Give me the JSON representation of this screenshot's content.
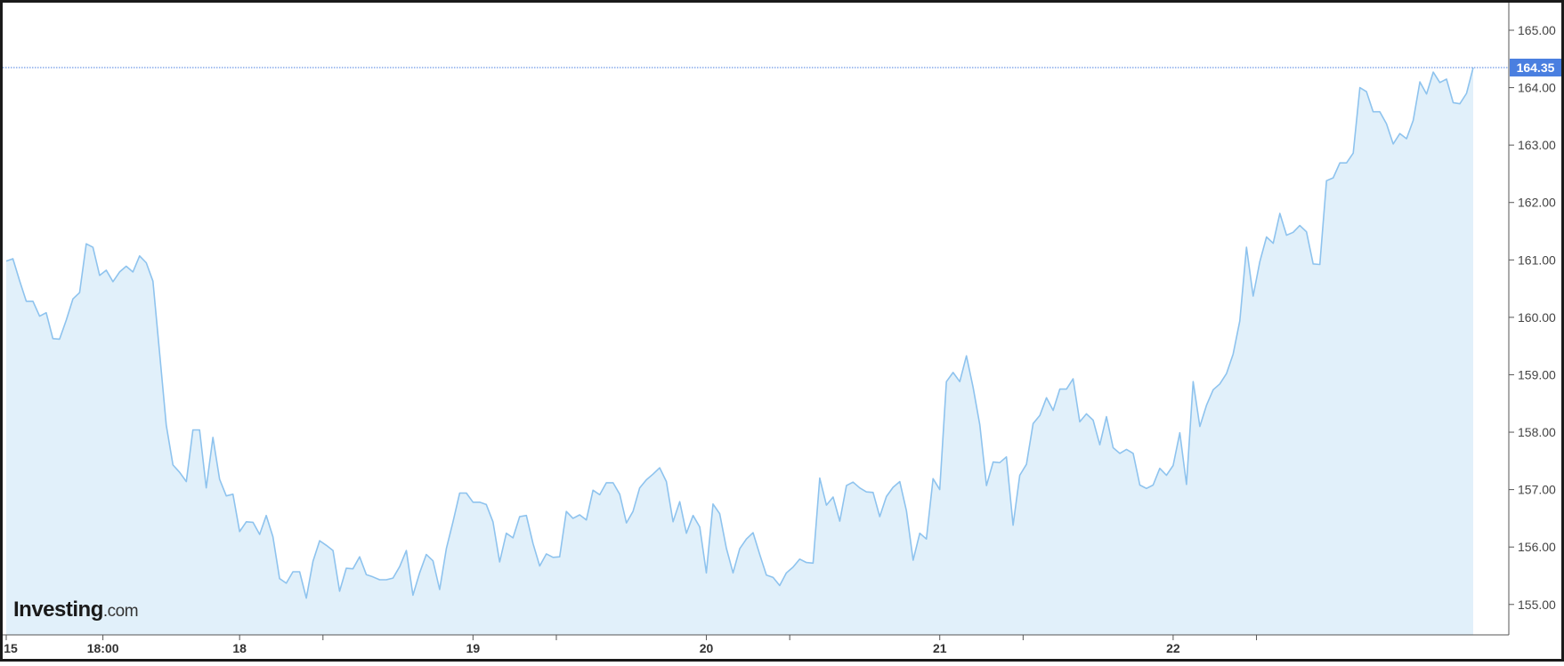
{
  "chart_data": {
    "type": "area",
    "title": "",
    "xlabel": "",
    "ylabel": "",
    "ylim": [
      154.47,
      165.48
    ],
    "y_ticks": [
      "155.00",
      "156.00",
      "157.00",
      "158.00",
      "159.00",
      "160.00",
      "161.00",
      "162.00",
      "163.00",
      "164.00",
      "165.00"
    ],
    "x_ticks": [
      {
        "label": "15",
        "i": 0
      },
      {
        "label": "18:00",
        "i": 14.5
      },
      {
        "label": "18",
        "i": 35
      },
      {
        "label": "",
        "i": 47.5
      },
      {
        "label": "19",
        "i": 70
      },
      {
        "label": "",
        "i": 82.5
      },
      {
        "label": "20",
        "i": 105
      },
      {
        "label": "",
        "i": 117.5
      },
      {
        "label": "21",
        "i": 140
      },
      {
        "label": "",
        "i": 152.5
      },
      {
        "label": "22",
        "i": 175
      },
      {
        "label": "",
        "i": 187.5
      }
    ],
    "current_value": "164.35",
    "grid": false,
    "colors": {
      "line": "#8ec3ee",
      "fill": "#e1f0fa",
      "price_tag": "#4a7fe0",
      "ref_line": "#4a7fe0"
    },
    "values": [
      160.98,
      161.02,
      160.64,
      160.28,
      160.28,
      160.02,
      160.08,
      159.63,
      159.62,
      159.95,
      160.32,
      160.43,
      161.28,
      161.22,
      160.73,
      160.82,
      160.62,
      160.79,
      160.89,
      160.79,
      161.07,
      160.95,
      160.63,
      159.38,
      158.12,
      157.43,
      157.3,
      157.14,
      158.04,
      158.04,
      157.03,
      157.91,
      157.18,
      156.89,
      156.92,
      156.27,
      156.44,
      156.43,
      156.22,
      156.55,
      156.18,
      155.45,
      155.37,
      155.57,
      155.57,
      155.11,
      155.75,
      156.11,
      156.03,
      155.94,
      155.23,
      155.63,
      155.62,
      155.83,
      155.52,
      155.48,
      155.43,
      155.43,
      155.46,
      155.66,
      155.94,
      155.16,
      155.55,
      155.87,
      155.76,
      155.26,
      155.97,
      156.44,
      156.94,
      156.94,
      156.78,
      156.78,
      156.74,
      156.44,
      155.74,
      156.24,
      156.16,
      156.53,
      156.55,
      156.06,
      155.67,
      155.88,
      155.82,
      155.83,
      156.62,
      156.5,
      156.56,
      156.47,
      156.99,
      156.91,
      157.12,
      157.12,
      156.92,
      156.42,
      156.62,
      157.03,
      157.17,
      157.27,
      157.38,
      157.14,
      156.44,
      156.79,
      156.24,
      156.55,
      156.35,
      155.55,
      156.75,
      156.58,
      155.98,
      155.55,
      155.97,
      156.14,
      156.25,
      155.87,
      155.51,
      155.47,
      155.33,
      155.55,
      155.65,
      155.79,
      155.73,
      155.72,
      157.2,
      156.73,
      156.87,
      156.45,
      157.07,
      157.13,
      157.03,
      156.96,
      156.95,
      156.53,
      156.88,
      157.04,
      157.14,
      156.63,
      155.77,
      156.24,
      156.14,
      157.19,
      157.0,
      158.88,
      159.04,
      158.88,
      159.33,
      158.78,
      158.13,
      157.07,
      157.48,
      157.47,
      157.57,
      156.38,
      157.25,
      157.44,
      158.15,
      158.29,
      158.6,
      158.38,
      158.75,
      158.75,
      158.93,
      158.18,
      158.32,
      158.21,
      157.78,
      158.27,
      157.73,
      157.63,
      157.7,
      157.63,
      157.08,
      157.02,
      157.08,
      157.37,
      157.25,
      157.42,
      157.99,
      157.09,
      158.88,
      158.1,
      158.47,
      158.74,
      158.84,
      159.02,
      159.36,
      159.94,
      161.22,
      160.37,
      160.97,
      161.4,
      161.29,
      161.81,
      161.43,
      161.48,
      161.6,
      161.49,
      160.93,
      160.92,
      162.38,
      162.43,
      162.69,
      162.69,
      162.86,
      164.0,
      163.93,
      163.58,
      163.58,
      163.37,
      163.02,
      163.2,
      163.11,
      163.43,
      164.1,
      163.89,
      164.27,
      164.09,
      164.15,
      163.74,
      163.72,
      163.9,
      164.35
    ]
  },
  "watermark": {
    "brand": "Investing",
    "suffix": ".com"
  }
}
